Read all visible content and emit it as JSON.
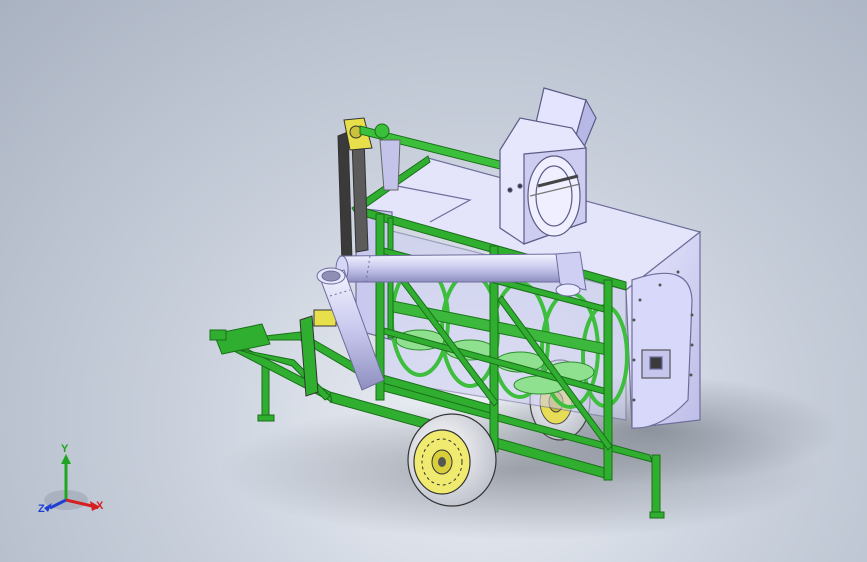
{
  "viewport": {
    "background": "cad-gradient-gray",
    "colors": {
      "frame_green": "#2fae2f",
      "frame_green_dark": "#1d7d1d",
      "panel_lavender": "#dcdcfa",
      "panel_edge": "#7c7ca8",
      "tire": "#f2f2f2",
      "rim_yellow": "#e8e24a",
      "axis_x": "#d42020",
      "axis_y": "#1fa51f",
      "axis_z": "#1f3fd4"
    }
  },
  "triad": {
    "x_label": "X",
    "y_label": "Y",
    "z_label": "Z"
  }
}
